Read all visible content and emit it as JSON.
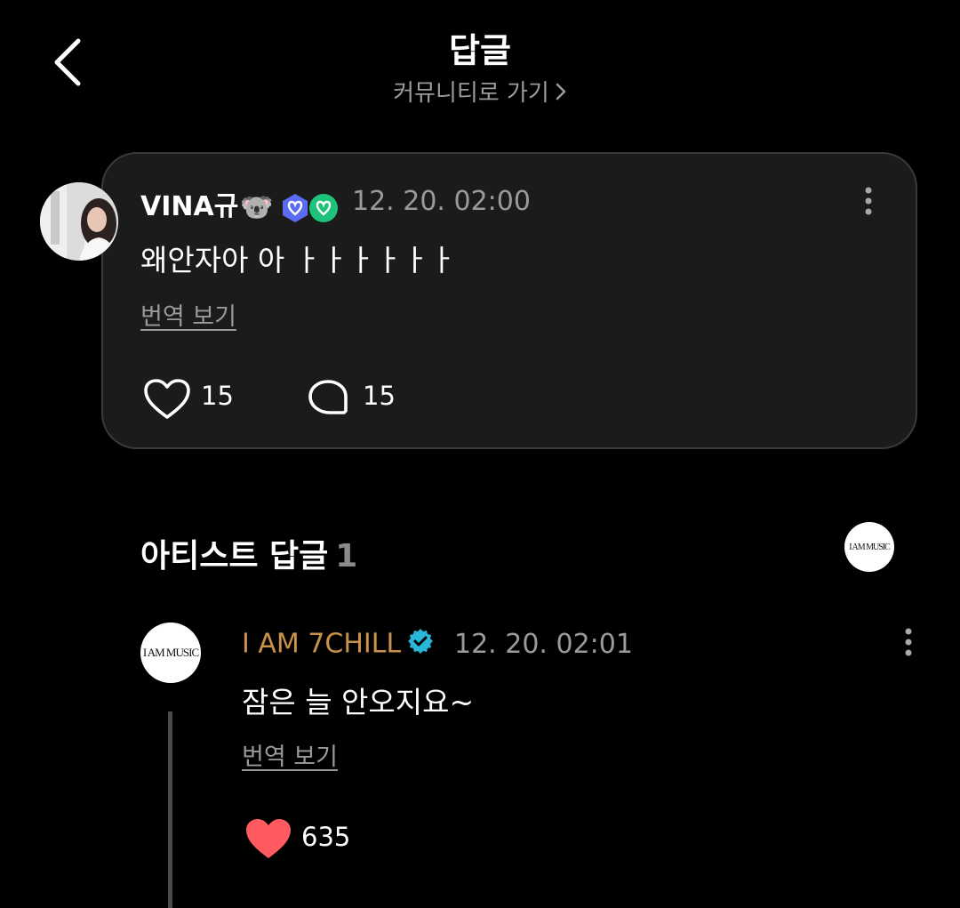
{
  "header": {
    "title": "답글",
    "community_link": "커뮤니티로 가기"
  },
  "original_comment": {
    "username": "VINA규",
    "badge_emoji": "🐨",
    "timestamp": "12. 20. 02:00",
    "text": "왜안자아 아 ㅏㅏㅏㅏㅏㅏ",
    "translate_label": "번역 보기",
    "like_count": "15",
    "reply_count": "15"
  },
  "artist_section": {
    "title": "아티스트 답글",
    "count": "1",
    "logo_text": "I AM MUSIC"
  },
  "artist_reply": {
    "logo_text": "I AM MUSIC",
    "name": "I AM 7CHILL",
    "timestamp": "12. 20. 02:01",
    "text": "잠은 늘 안오지요~",
    "translate_label": "번역 보기",
    "like_count": "635"
  },
  "colors": {
    "background": "#000000",
    "card": "#1b1b1b",
    "artist_name": "#c9914a",
    "liked_heart": "#ff5a5f",
    "verified": "#29b6d8"
  }
}
